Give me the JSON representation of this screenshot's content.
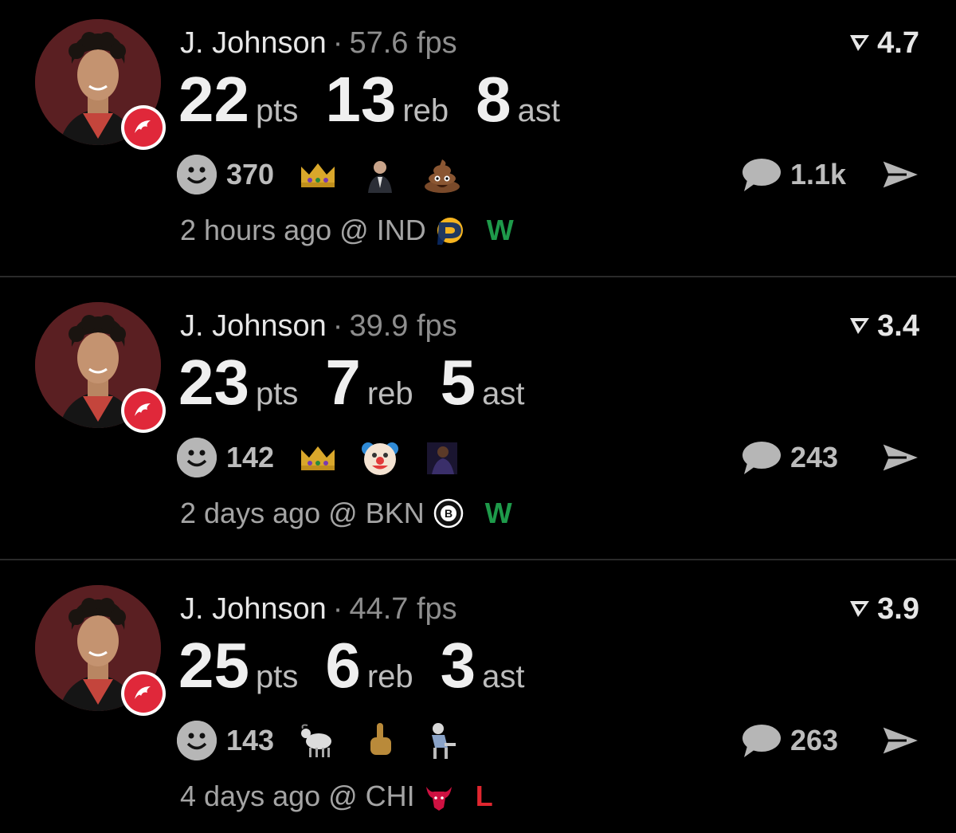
{
  "colors": {
    "background": "#000000",
    "win": "#1e9a4a",
    "loss": "#e0262f",
    "team": "#e0283a"
  },
  "posts": [
    {
      "player": "J. Johnson",
      "separator": "·",
      "fps": "57.6 fps",
      "rating": "4.7",
      "pts": "22",
      "pts_label": "pts",
      "reb": "13",
      "reb_label": "reb",
      "ast": "8",
      "ast_label": "ast",
      "reaction_count": "370",
      "reactions": [
        "crown-emoji",
        "commissioner-emoji",
        "poop-emoji"
      ],
      "comment_count": "1.1k",
      "time": "2 hours ago @ IND",
      "opponent_logo": "pacers-logo",
      "result": "W"
    },
    {
      "player": "J. Johnson",
      "separator": "·",
      "fps": "39.9 fps",
      "rating": "3.4",
      "pts": "23",
      "pts_label": "pts",
      "reb": "7",
      "reb_label": "reb",
      "ast": "5",
      "ast_label": "ast",
      "reaction_count": "142",
      "reactions": [
        "crown-emoji",
        "clown-emoji",
        "player-emoji"
      ],
      "comment_count": "243",
      "time": "2 days ago @ BKN",
      "opponent_logo": "nets-logo",
      "result": "W"
    },
    {
      "player": "J. Johnson",
      "separator": "·",
      "fps": "44.7 fps",
      "rating": "3.9",
      "pts": "25",
      "pts_label": "pts",
      "reb": "6",
      "reb_label": "reb",
      "ast": "3",
      "ast_label": "ast",
      "reaction_count": "143",
      "reactions": [
        "goat-emoji",
        "middle-finger-emoji",
        "thinker-emoji"
      ],
      "comment_count": "263",
      "time": "4 days ago @ CHI",
      "opponent_logo": "bulls-logo",
      "result": "L"
    }
  ]
}
